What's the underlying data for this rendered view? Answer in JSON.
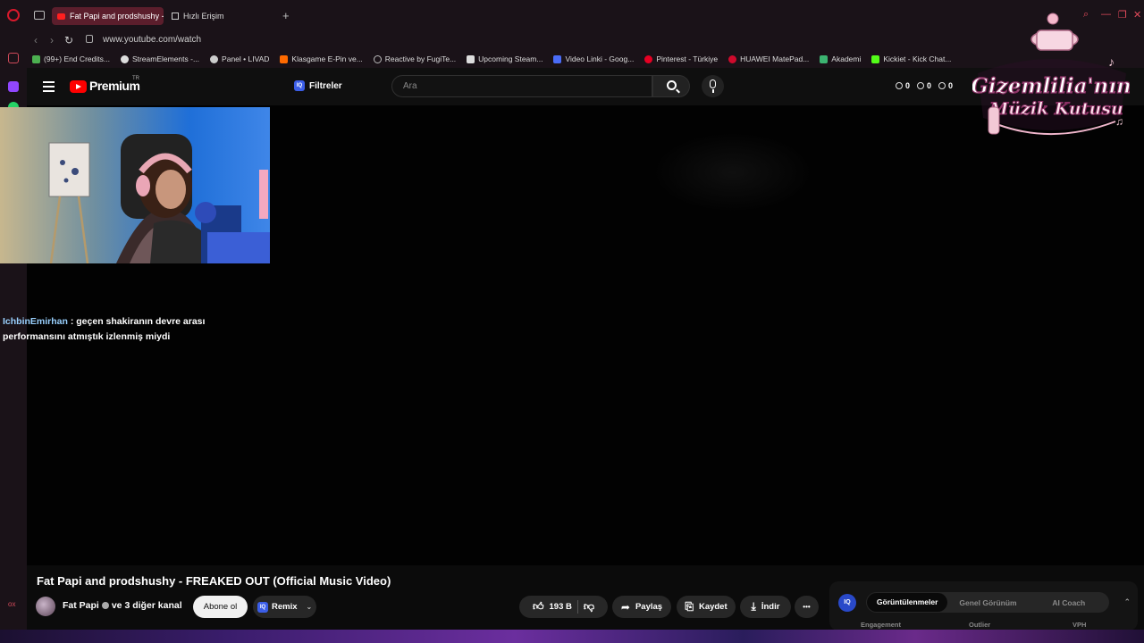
{
  "browser": {
    "tabs": [
      {
        "label": "Fat Papi and prodshushy -",
        "active": true
      },
      {
        "label": "Hızlı Erişim",
        "active": false
      }
    ],
    "new_tab": "+",
    "url": "www.youtube.com/watch",
    "bookmarks": [
      {
        "label": "(99+) End Credits...",
        "color": "#4caf50"
      },
      {
        "label": "StreamElements -...",
        "color": "#dddddd"
      },
      {
        "label": "Panel • LIVAD",
        "color": "#cccccc"
      },
      {
        "label": "Klasgame E-Pin ve...",
        "color": "#ff6a00"
      },
      {
        "label": "Reactive by FugiTe...",
        "color": "#bbbbbb"
      },
      {
        "label": "Upcoming Steam...",
        "color": "#dddddd"
      },
      {
        "label": "Video Linki - Goog...",
        "color": "#4a6cf7"
      },
      {
        "label": "Pinterest - Türkiye",
        "color": "#e60023"
      },
      {
        "label": "HUAWEI MatePad...",
        "color": "#cf0a2c"
      },
      {
        "label": "Akademi",
        "color": "#3cb371"
      },
      {
        "label": "Kickiet - Kick Chat...",
        "color": "#53fc18"
      }
    ]
  },
  "youtube": {
    "logo_text": "Premium",
    "region": "TR",
    "filters_label": "Filtreler",
    "iq_badge": "IQ",
    "search_placeholder": "Ara",
    "stats": [
      "0",
      "0",
      "0"
    ]
  },
  "overlay": {
    "logo_line1": "Gizemlilia'nın",
    "logo_line2": "Müzik Kutusu"
  },
  "chat": {
    "user": "IchbinEmirhan",
    "message": ": geçen shakiranın devre arası performansını atmıştık izlenmiş miydi"
  },
  "video": {
    "title": "Fat Papi and prodshushy - FREAKED OUT (Official Music Video)",
    "channel": "Fat Papi",
    "channel_suffix": "ve 3 diğer kanal",
    "subscribe_label": "Abone ol",
    "remix_label": "Remix",
    "likes": "193 B",
    "share_label": "Paylaş",
    "save_label": "Kaydet",
    "download_label": "İndir",
    "more_label": "•••"
  },
  "iq_panel": {
    "logo": "IQ",
    "tabs": [
      "Görüntülenmeler",
      "Genel Görünüm",
      "AI Coach"
    ],
    "active_tab": 0,
    "subheaders": [
      "Engagement",
      "Outlier",
      "VPH"
    ]
  }
}
